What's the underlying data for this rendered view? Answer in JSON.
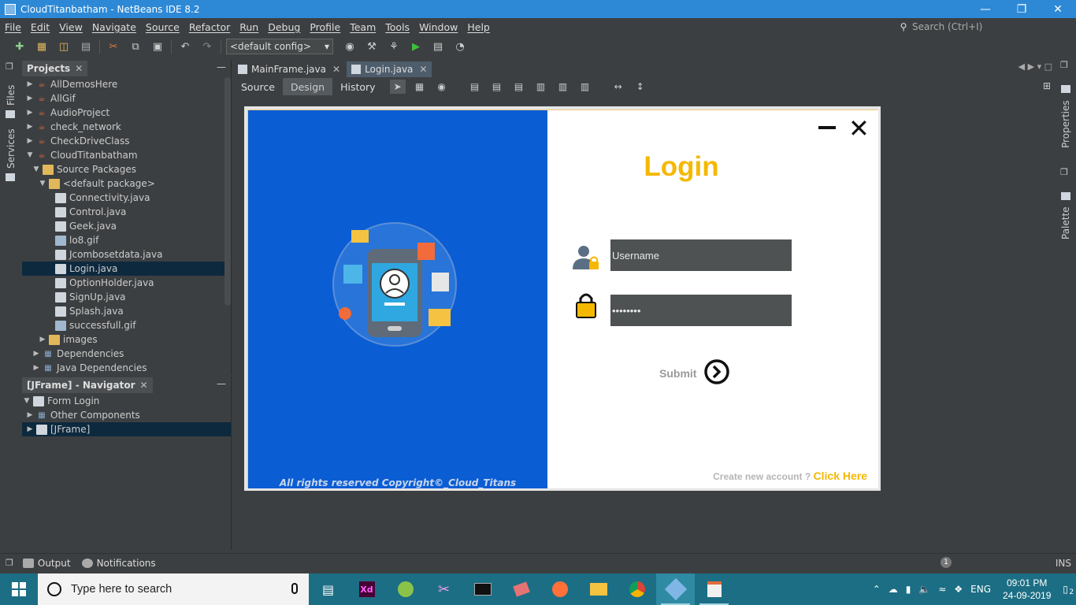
{
  "window": {
    "title": "CloudTitanbatham - NetBeans IDE 8.2"
  },
  "menu": [
    "File",
    "Edit",
    "View",
    "Navigate",
    "Source",
    "Refactor",
    "Run",
    "Debug",
    "Profile",
    "Team",
    "Tools",
    "Window",
    "Help"
  ],
  "search": {
    "placeholder": "Search (Ctrl+I)"
  },
  "toolbar": {
    "config_value": "<default config>"
  },
  "side_left": {
    "files": "Files",
    "services": "Services"
  },
  "side_right": {
    "properties": "Properties",
    "palette": "Palette"
  },
  "projects": {
    "title": "Projects",
    "nodes": [
      {
        "label": "AllDemosHere"
      },
      {
        "label": "AllGif"
      },
      {
        "label": "AudioProject"
      },
      {
        "label": "check_network"
      },
      {
        "label": "CheckDriveClass"
      },
      {
        "label": "CloudTitanbatham"
      },
      {
        "label": "Source Packages"
      },
      {
        "label": "<default package>"
      },
      {
        "label": "Connectivity.java"
      },
      {
        "label": "Control.java"
      },
      {
        "label": "Geek.java"
      },
      {
        "label": "lo8.gif"
      },
      {
        "label": "Jcombosetdata.java"
      },
      {
        "label": "Login.java"
      },
      {
        "label": "OptionHolder.java"
      },
      {
        "label": "SignUp.java"
      },
      {
        "label": "Splash.java"
      },
      {
        "label": "successfull.gif"
      },
      {
        "label": "images"
      },
      {
        "label": "Dependencies"
      },
      {
        "label": "Java Dependencies"
      }
    ]
  },
  "navigator": {
    "title": "[JFrame] - Navigator",
    "nodes": [
      {
        "label": "Form Login"
      },
      {
        "label": "Other Components"
      },
      {
        "label": "[JFrame]"
      }
    ]
  },
  "editor": {
    "tabs": [
      {
        "label": "MainFrame.java"
      },
      {
        "label": "Login.java"
      }
    ],
    "modes": [
      "Source",
      "Design",
      "History"
    ]
  },
  "form": {
    "title": "Login",
    "username_placeholder": "Username",
    "password_value": "••••••••",
    "submit_label": "Submit",
    "create_prompt": "Create new account ?",
    "create_link": "Click Here",
    "copyright": "All rights reserved Copyright©_Cloud_Titans",
    "colors": {
      "blue": "#0b5dd4",
      "accent": "#f5b800",
      "field": "#4e5253"
    }
  },
  "statusbar": {
    "output": "Output",
    "notifications": "Notifications",
    "badge": "1",
    "mode": "INS"
  },
  "taskbar": {
    "search_placeholder": "Type here to search",
    "apps": [
      "task-view",
      "adobe-xd",
      "chameleon",
      "snipping",
      "terminal",
      "eraser",
      "firefox",
      "file-explorer",
      "chrome",
      "netbeans",
      "java"
    ],
    "xd_label": "Xd",
    "language": "ENG",
    "time": "09:01 PM",
    "date": "24-09-2019",
    "notification_count": "2"
  }
}
